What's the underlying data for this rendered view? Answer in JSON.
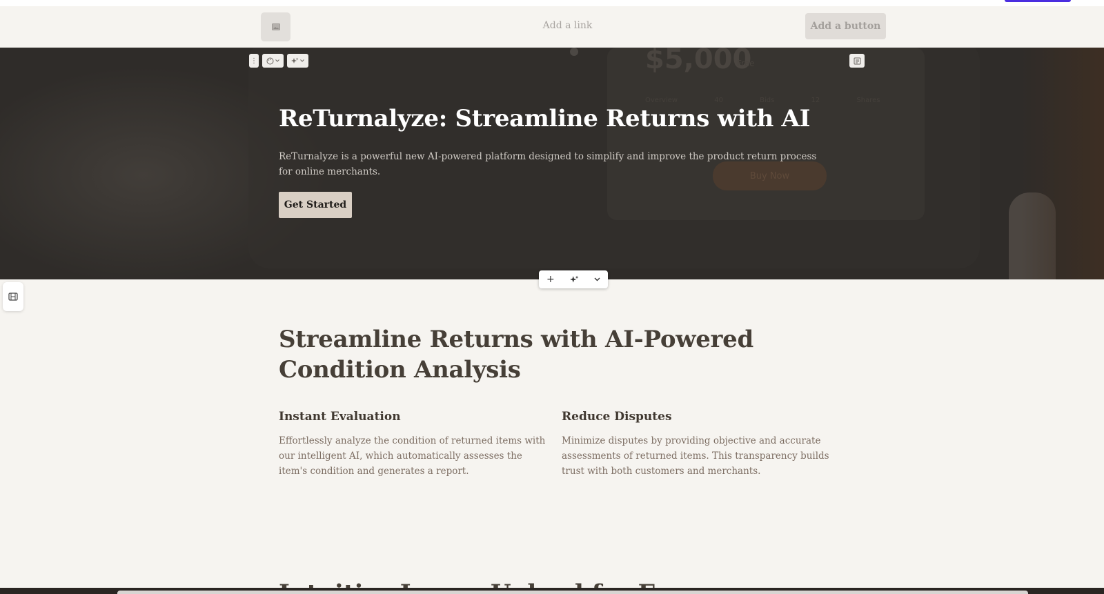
{
  "nav": {
    "link_label": "Add a link",
    "button_label": "Add a button"
  },
  "hero": {
    "title": "ReTurnalyze: Streamline Returns with AI",
    "description": "ReTurnalyze is a powerful new AI-powered platform designed to simplify and improve the product return process for online merchants.",
    "cta_label": "Get Started",
    "background": {
      "price": "$5,000",
      "price_sub": "Free",
      "stats": "Overview 40 Bids 12 Shares",
      "cta": "Buy Now"
    }
  },
  "toolbar": {
    "more_icon": "⋮",
    "palette_icon": "palette-icon",
    "sparkle_icon": "sparkle-icon",
    "add_icon": "+",
    "chevron_icon": "⌄"
  },
  "features": {
    "title": "Streamline Returns with AI-Powered Condition Analysis",
    "items": [
      {
        "title": "Instant Evaluation",
        "text": "Effortlessly analyze the condition of returned items with our intelligent AI, which automatically assesses the item's condition and generates a report."
      },
      {
        "title": "Reduce Disputes",
        "text": "Minimize disputes by providing objective and accurate assessments of returned items. This transparency builds trust with both customers and merchants."
      }
    ]
  },
  "next_section": {
    "title": "Intuitive Image Upload for E"
  },
  "colors": {
    "accent": "#4b2ee0",
    "hero_bg": "#2f2c29",
    "cta_bg": "#d9cfc4",
    "page_bg": "#f6f4f0"
  }
}
